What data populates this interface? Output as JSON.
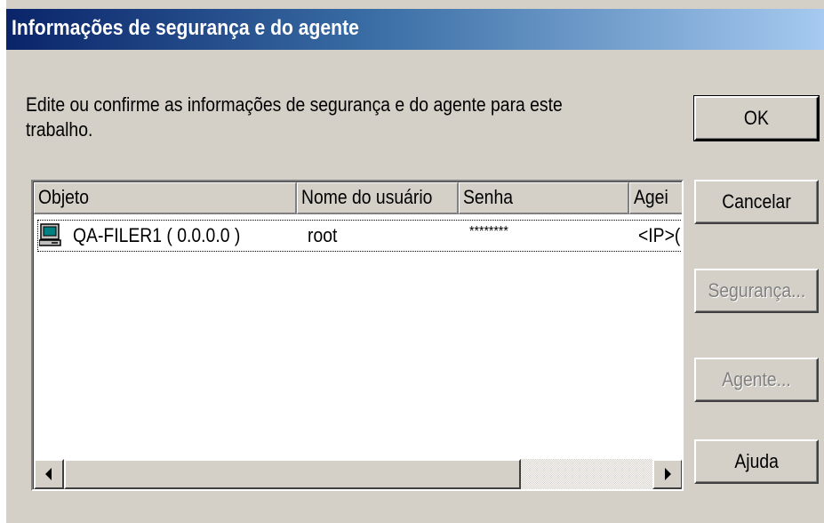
{
  "window": {
    "title": "Informações de segurança e do agente"
  },
  "description": {
    "line1": "Edite ou confirme as informações de segurança e do agente para este",
    "line2": "trabalho."
  },
  "buttons": {
    "ok": "OK",
    "cancel": "Cancelar",
    "security": "Segurança...",
    "agent": "Agente...",
    "help": "Ajuda"
  },
  "table": {
    "columns": [
      "Objeto",
      "Nome do usuário",
      "Senha",
      "Agei"
    ],
    "rows": [
      {
        "object": "QA-FILER1 ( 0.0.0.0 )",
        "username": "root",
        "password": "********",
        "agent": "<IP>("
      }
    ]
  },
  "icons": {
    "row_icon": "computer-icon",
    "scroll_left": "arrow-left-icon",
    "scroll_right": "arrow-right-icon"
  },
  "colors": {
    "title_start": "#0a246a",
    "title_end": "#a6caf0",
    "face": "#d4d0c8"
  }
}
